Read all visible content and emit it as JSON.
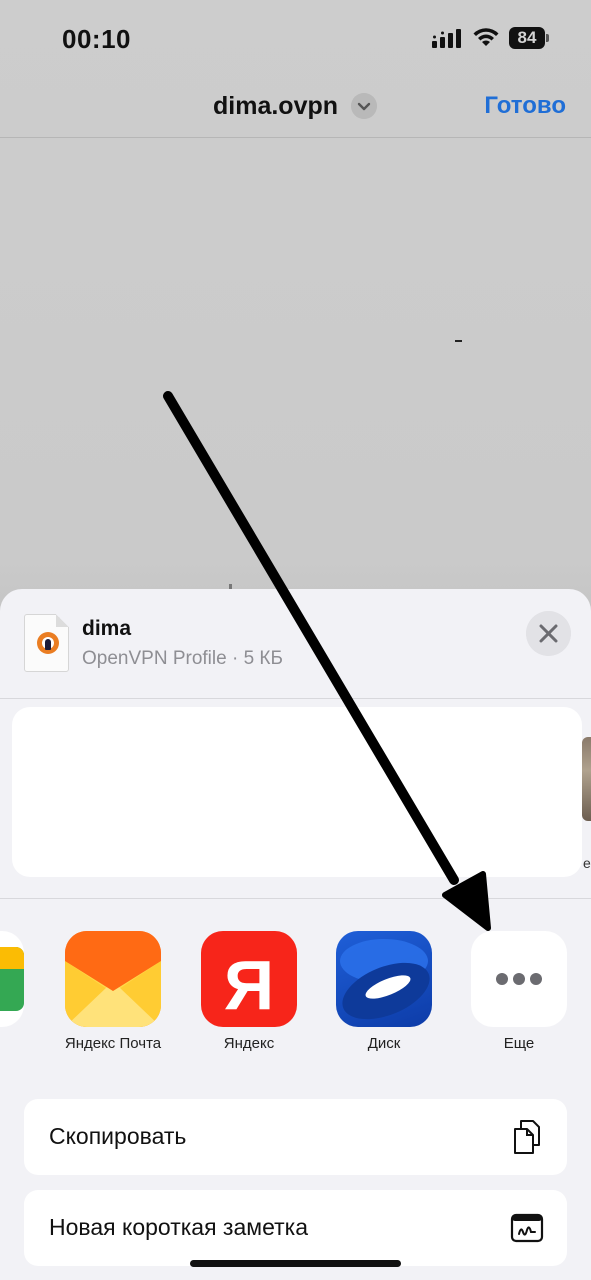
{
  "status_bar": {
    "time": "00:10",
    "battery": "84"
  },
  "nav": {
    "title": "dima.ovpn",
    "done_label": "Готово"
  },
  "share_sheet": {
    "file_name": "dima",
    "file_subtitle": "OpenVPN Profile · 5 КБ",
    "peek_label": "е",
    "apps": [
      {
        "label": "Яндекс Почта",
        "icon": "yandex-mail-icon"
      },
      {
        "label": "Яндекс",
        "icon": "yandex-icon"
      },
      {
        "label": "Диск",
        "icon": "yandex-disk-icon"
      },
      {
        "label": "Еще",
        "icon": "more-icon"
      }
    ],
    "actions": [
      {
        "label": "Скопировать",
        "icon": "copy-icon"
      },
      {
        "label": "Новая короткая заметка",
        "icon": "quick-note-icon"
      }
    ]
  },
  "colors": {
    "accent": "#1f6ed6",
    "sheet_bg": "#f2f2f6",
    "yandex_red": "#f7251a"
  }
}
